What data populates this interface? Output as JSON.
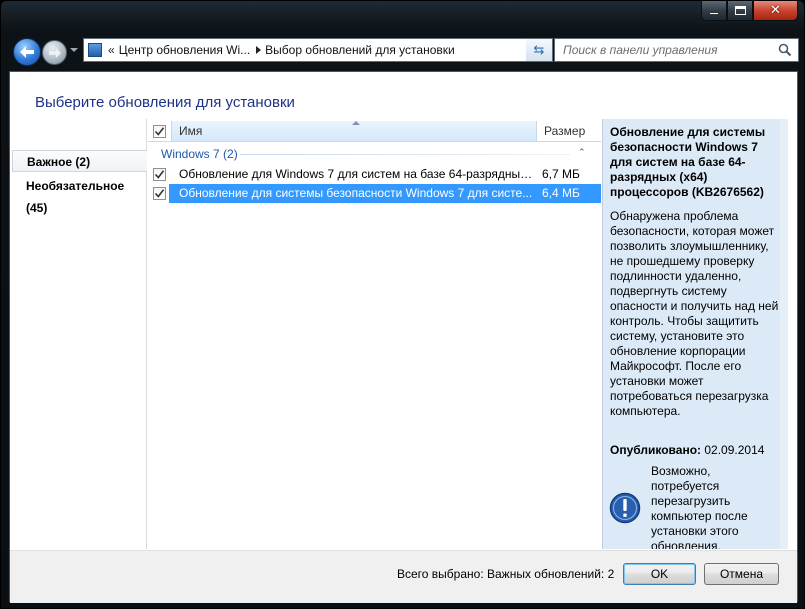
{
  "nav": {
    "address_chevrons": "«",
    "address_segments": [
      "Центр обновления Wi...",
      "Выбор обновлений для установки"
    ],
    "search_placeholder": "Поиск в панели управления"
  },
  "page": {
    "title": "Выберите обновления для установки"
  },
  "categories": [
    {
      "label": "Важное (2)",
      "selected": true
    },
    {
      "label": "Необязательное (45)",
      "selected": false
    }
  ],
  "list": {
    "columns": {
      "name": "Имя",
      "size": "Размер"
    },
    "group": {
      "label": "Windows 7 (2)",
      "collapse_glyph": "⌃"
    },
    "rows": [
      {
        "name": "Обновление для Windows 7 для систем на базе 64-разрядных ...",
        "size": "6,7 МБ",
        "checked": true,
        "selected": false
      },
      {
        "name": "Обновление для системы безопасности Windows 7 для систе...",
        "size": "6,4 МБ",
        "checked": true,
        "selected": true
      }
    ]
  },
  "detail": {
    "title": "Обновление для системы безопасности Windows 7 для систем на базе 64-разрядных (x64) процессоров (KB2676562)",
    "body": "Обнаружена проблема безопасности, которая может позволить злоумышленнику, не прошедшему проверку подлинности удаленно, подвергнуть систему опасности и получить над ней контроль. Чтобы защитить систему, установите это обновление корпорации Майкрософт. После его установки может потребоваться перезагрузка компьютера.",
    "published_label": "Опубликовано:",
    "published_date": "02.09.2014",
    "restart_note": "Возможно, потребуется перезагрузить компьютер после установки этого обновления."
  },
  "footer": {
    "summary": "Всего выбрано: Важных обновлений: 2",
    "ok_label": "OK",
    "cancel_label": "Отмена"
  },
  "colors": {
    "title_blue": "#1e3287",
    "selection": "#3399ff",
    "detail_bg": "#dceaf7"
  }
}
